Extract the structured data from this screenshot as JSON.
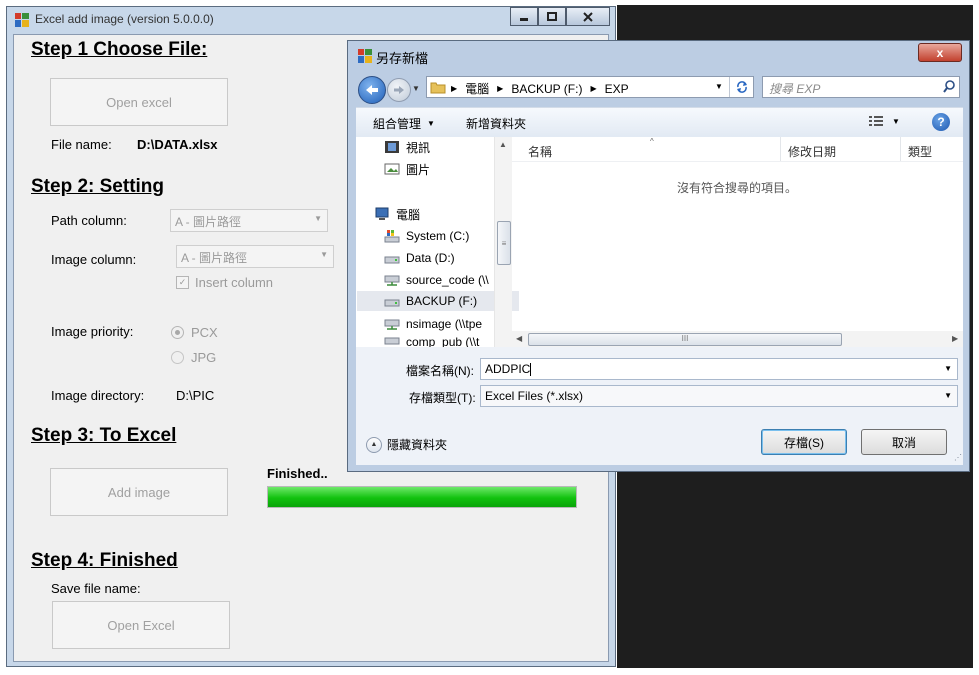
{
  "main_window": {
    "title": "Excel add image (version 5.0.0.0)",
    "step1": {
      "heading": "Step 1 Choose File:",
      "open_button": "Open excel",
      "file_label": "File name:",
      "file_value": "D:\\DATA.xlsx"
    },
    "step2": {
      "heading": "Step 2: Setting",
      "path_label": "Path column:",
      "path_value": "A - 圖片路徑",
      "image_label": "Image column:",
      "image_value": "A - 圖片路徑",
      "insert_column": "Insert column",
      "priority_label": "Image priority:",
      "priority_options": [
        "PCX",
        "JPG"
      ],
      "directory_label": "Image directory:",
      "directory_value": "D:\\PIC"
    },
    "step3": {
      "heading": "Step 3: To Excel",
      "add_button": "Add image",
      "status": "Finished..",
      "progress": 1.0
    },
    "step4": {
      "heading": "Step 4: Finished",
      "save_label": "Save file name:",
      "open_button": "Open Excel"
    }
  },
  "dialog": {
    "title": "另存新檔",
    "close_glyph": "x",
    "breadcrumb": [
      "電腦",
      "BACKUP (F:)",
      "EXP"
    ],
    "search_placeholder": "搜尋 EXP",
    "toolbar": {
      "organize": "組合管理",
      "new_folder": "新增資料夾"
    },
    "nav_items": [
      {
        "label": "視訊",
        "icon": "video-icon"
      },
      {
        "label": "圖片",
        "icon": "picture-icon"
      },
      {
        "label": "電腦",
        "icon": "computer-icon"
      },
      {
        "label": "System (C:)",
        "icon": "system-drive-icon"
      },
      {
        "label": "Data (D:)",
        "icon": "drive-icon"
      },
      {
        "label": "source_code (\\\\",
        "icon": "network-drive-icon"
      },
      {
        "label": "BACKUP (F:)",
        "icon": "drive-icon"
      },
      {
        "label": "nsimage (\\\\tpe",
        "icon": "network-drive-icon"
      },
      {
        "label": "comp_pub (\\\\t",
        "icon": "network-drive-icon"
      }
    ],
    "columns": [
      "名稱",
      "修改日期",
      "類型"
    ],
    "empty_message": "沒有符合搜尋的項目。",
    "filename_label": "檔案名稱(N):",
    "filename_value": "ADDPIC",
    "filetype_label": "存檔類型(T):",
    "filetype_value": "Excel Files (*.xlsx)",
    "hide_folders": "隱藏資料夾",
    "save_button": "存檔(S)",
    "cancel_button": "取消"
  },
  "colors": {
    "progress_fill": "#12c20f",
    "window_frame": "#c7d7e9",
    "close_red": "#c2412e"
  }
}
